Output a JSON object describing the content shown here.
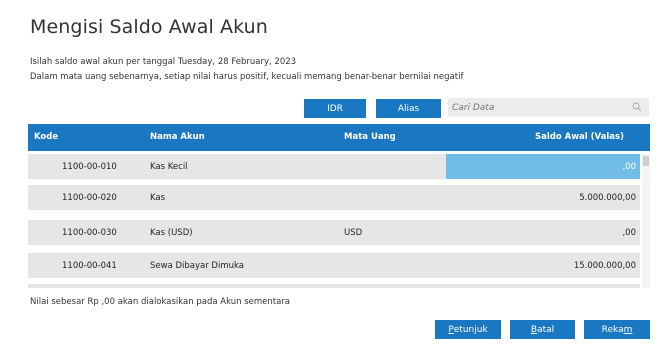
{
  "title": "Mengisi Saldo Awal Akun",
  "info_line1": "Isilah saldo awal akun per tanggal Tuesday, 28 February, 2023",
  "info_line2": "Dalam mata uang sebenarnya, setiap nilai harus positif, kecuali memang benar-benar bernilai negatif",
  "toolbar": {
    "idr_label": "IDR",
    "alias_label": "Alias",
    "search_placeholder": "Cari Data",
    "search_icon": "search-icon"
  },
  "table": {
    "headers": {
      "kode": "Kode",
      "nama": "Nama Akun",
      "mata_uang": "Mata Uang",
      "saldo": "Saldo Awal (Valas)"
    },
    "rows": [
      {
        "kode": "1100-00-010",
        "nama": "Kas Kecil",
        "mata_uang": "",
        "saldo": ",00",
        "selected": true
      },
      {
        "kode": "1100-00-020",
        "nama": "Kas",
        "mata_uang": "",
        "saldo": "5.000.000,00"
      },
      {
        "kode": "1100-00-030",
        "nama": "Kas (USD)",
        "mata_uang": "USD",
        "saldo": ",00"
      },
      {
        "kode": "1100-00-041",
        "nama": "Sewa Dibayar Dimuka",
        "mata_uang": "",
        "saldo": "15.000.000,00"
      }
    ]
  },
  "footer_note": "Nilai sebesar Rp ,00 akan dialokasikan pada Akun sementara",
  "buttons": {
    "petunjuk_pre": "",
    "petunjuk_ul": "P",
    "petunjuk_post": "etunjuk",
    "batal_pre": "",
    "batal_ul": "B",
    "batal_post": "atal",
    "rekam_pre": "Reka",
    "rekam_ul": "m",
    "rekam_post": ""
  },
  "colors": {
    "accent": "#1a78c2",
    "selected_cell": "#72bde8",
    "row_bg": "#e6e6e6"
  }
}
